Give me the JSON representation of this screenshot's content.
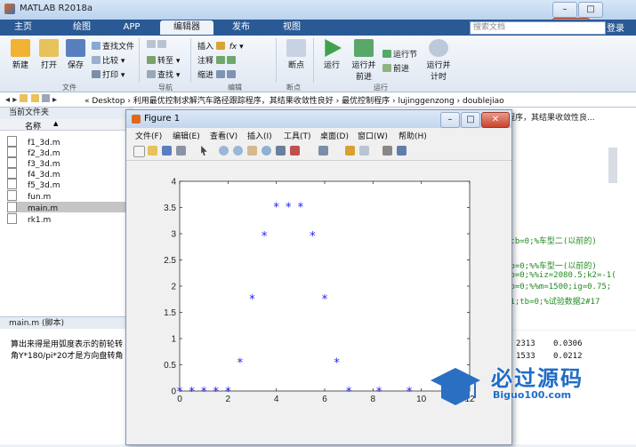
{
  "window": {
    "title": "MATLAB R2018a"
  },
  "tabs": [
    "主页",
    "绘图",
    "APP",
    "编辑器",
    "发布",
    "视图"
  ],
  "active_tab": "编辑器",
  "search": {
    "placeholder": "搜索文档"
  },
  "login": "登录",
  "ribbon": {
    "file": {
      "new": "新建",
      "open": "打开",
      "save": "保存",
      "find_files": "查找文件",
      "compare": "比较",
      "print": "打印",
      "group": "文件"
    },
    "nav": {
      "goto": "转至",
      "find": "查找",
      "group": "导航"
    },
    "edit": {
      "insert": "插入",
      "comment": "注释",
      "indent": "缩进",
      "group": "编辑",
      "fx": "fx"
    },
    "breakpoints": {
      "bp": "断点",
      "group": "断点"
    },
    "run": {
      "run": "运行",
      "run_advance": "运行并\n前进",
      "run_section": "运行节",
      "advance": "前进",
      "run_time": "运行并\n计时",
      "group": "运行"
    }
  },
  "address": {
    "path": "«  Desktop  ›  利用最优控制求解汽车路径跟踪程序，其结果收敛性良好  ›  最优控制程序  ›  lujinggenzong  ›  doublejiao"
  },
  "current_folder": {
    "header": "当前文件夹",
    "col_name": "名称",
    "col_arrow": "▲",
    "files": [
      "f1_3d.m",
      "f2_3d.m",
      "f3_3d.m",
      "f4_3d.m",
      "f5_3d.m",
      "fun.m",
      "main.m",
      "rk1.m"
    ],
    "selected": "main.m"
  },
  "details": {
    "header": "main.m  (脚本)",
    "lines": [
      "算出来得是用弧度表示的前轮转",
      "角Y*180/pi*20才是方向盘转角"
    ]
  },
  "editor": {
    "header_snippet": "程序，其结果收敛性良...",
    "code_lines": [
      ";tb=0;%车型二(以前的)",
      "tb=0;%%车型一(以前的)",
      "tb=0;%%iz=2080.5;k2=-1(",
      "tb=0;%%m=1500;ig=0.75;",
      "=1;tb=0;%试验数据2#17"
    ]
  },
  "workspace_values": [
    [
      "2313",
      "0.0306"
    ],
    [
      "1533",
      "0.0212"
    ]
  ],
  "figure": {
    "title": "Figure 1",
    "menu": [
      "文件(F)",
      "编辑(E)",
      "查看(V)",
      "插入(I)",
      "工具(T)",
      "桌面(D)",
      "窗口(W)",
      "帮助(H)"
    ]
  },
  "chart_data": {
    "type": "scatter",
    "marker": "*",
    "color": "#1a1aff",
    "title": "",
    "xlabel": "",
    "ylabel": "",
    "xlim": [
      0,
      12
    ],
    "ylim": [
      0,
      4
    ],
    "xticks": [
      0,
      2,
      4,
      6,
      8,
      10,
      12
    ],
    "yticks": [
      0,
      0.5,
      1,
      1.5,
      2,
      2.5,
      3,
      3.5,
      4
    ],
    "ytick_labels": [
      "0",
      "0.5",
      "1",
      "1.5",
      "2",
      "2.5",
      "3",
      "3.5",
      "4"
    ],
    "x": [
      0,
      0.5,
      1,
      1.5,
      2,
      2.5,
      3,
      3.5,
      4,
      4.5,
      5,
      5.5,
      6,
      6.5,
      7,
      8.25,
      9.5,
      11,
      11.5
    ],
    "y": [
      0,
      0,
      0,
      0,
      0,
      0.55,
      1.76,
      2.97,
      3.52,
      3.52,
      3.52,
      2.97,
      1.76,
      0.55,
      0,
      0,
      0,
      0,
      0
    ],
    "grid": false
  },
  "watermark": {
    "text": "必过源码",
    "url": "Biguo100.com"
  }
}
